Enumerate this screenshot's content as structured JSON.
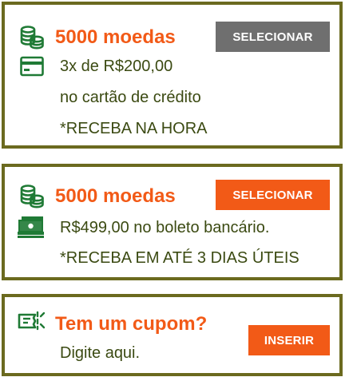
{
  "colors": {
    "border": "#6b6a1f",
    "accent": "#f25a17",
    "icon_green": "#1f7a35",
    "text": "#3b4a12",
    "button_disabled": "#6f6f6f",
    "button_active": "#f25a17"
  },
  "offers": [
    {
      "icon": "coins-stack-icon",
      "title": "5000 moedas",
      "payment_icon": "credit-card-icon",
      "lines": [
        "3x de R$200,00",
        "no cartão de crédito",
        "*RECEBA NA HORA"
      ],
      "button": {
        "label": "SELECIONAR",
        "state": "selected"
      }
    },
    {
      "icon": "coins-stack-icon",
      "title": "5000 moedas",
      "payment_icon": "cash-bills-icon",
      "lines": [
        "R$499,00 no boleto bancário.",
        "*RECEBA EM ATÉ 3 DIAS ÚTEIS"
      ],
      "button": {
        "label": "SELECIONAR",
        "state": "default"
      }
    }
  ],
  "coupon": {
    "icon": "ticket-icon",
    "title": "Tem um cupom?",
    "subtitle": "Digite aqui.",
    "button": {
      "label": "INSERIR"
    }
  }
}
